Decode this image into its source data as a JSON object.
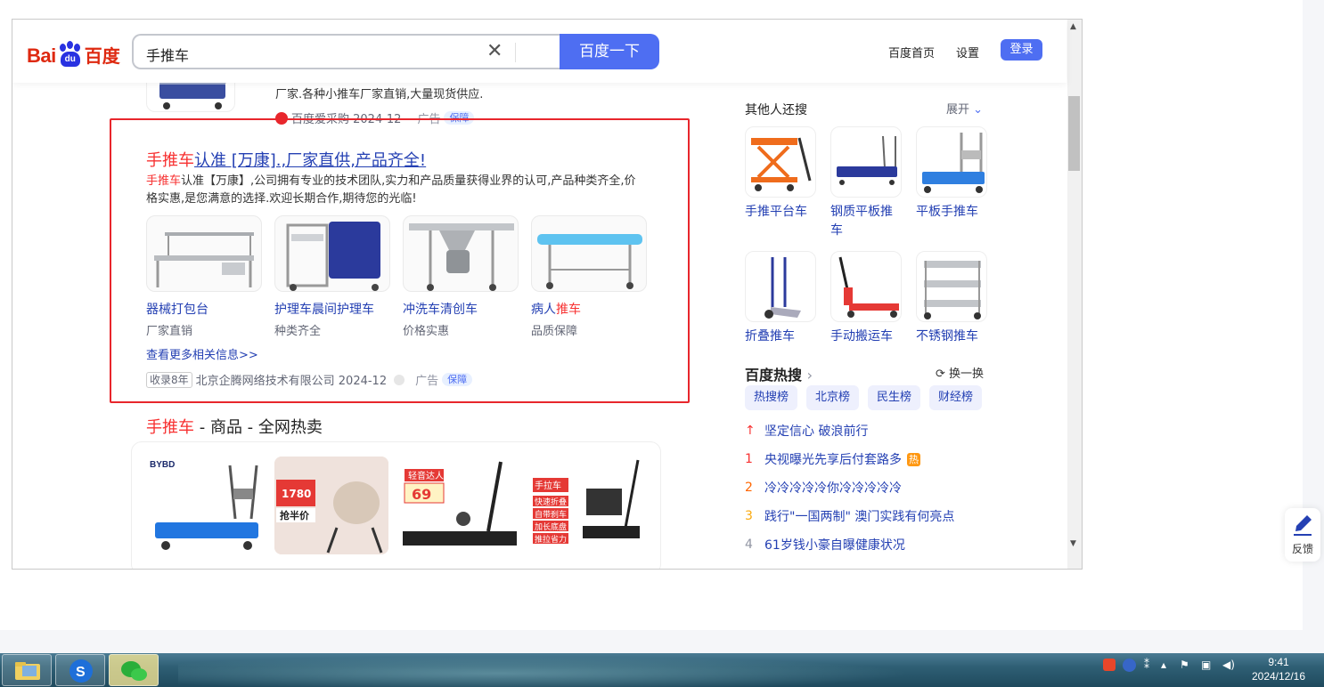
{
  "header": {
    "logo_bai": "Bai",
    "logo_du": "du",
    "logo_cn": "百度",
    "query": "手推车",
    "search_button": "百度一下",
    "nav_home": "百度首页",
    "nav_settings": "设置",
    "login": "登录"
  },
  "top_result": {
    "line1": "厂家.各种小推车厂家直销,大量现货供应.",
    "source": "百度爱采购 2024-12",
    "ad": "广告",
    "bao": "保障"
  },
  "ad_result": {
    "title_hl": "手推车",
    "title_rest": "认准 [万康].,厂家直供,产品齐全!",
    "snippet_hl": "手推车",
    "snippet_rest": "认准【万康】,公司拥有专业的技术团队,实力和产品质量获得业界的认可,产品种类齐全,价格实惠,是您满意的选择.欢迎长期合作,期待您的光临!",
    "tiles": [
      {
        "name": "器械打包台",
        "sub": "厂家直销"
      },
      {
        "name": "护理车晨间护理车",
        "sub": "种类齐全"
      },
      {
        "name": "冲洗车清创车",
        "sub": "价格实惠"
      },
      {
        "name_a": "病人",
        "name_b": "推车",
        "sub": "品质保障"
      }
    ],
    "more": "查看更多相关信息>>",
    "tag": "收录8年",
    "company": "北京企腾网络技术有限公司 2024-12",
    "ad": "广告",
    "bao": "保障"
  },
  "shopping": {
    "title_hl": "手推车",
    "title_rest": " - 商品 - 全网热卖",
    "p1_brand": "BYBD",
    "p2_price": "1780",
    "p2_promo": "抢半价",
    "p3_badge": "轻音达人",
    "p3_price": "69",
    "p4_badge": "手拉车",
    "p4_lines": [
      "快速折叠",
      "自带刹车",
      "加长底盘",
      "推拉省力"
    ]
  },
  "related": {
    "title": "其他人还搜",
    "expand": "展开",
    "items": [
      "手推平台车",
      "钢质平板推车",
      "平板手推车",
      "折叠推车",
      "手动搬运车",
      "不锈钢推车"
    ]
  },
  "hot": {
    "title": "百度热搜",
    "refresh": "换一换",
    "tabs": [
      "热搜榜",
      "北京榜",
      "民生榜",
      "财经榜"
    ],
    "rows": [
      {
        "rank": "↑",
        "text": "坚定信心 破浪前行",
        "color": "#f73131"
      },
      {
        "rank": "1",
        "text": "央视曝光先享后付套路多",
        "color": "#f73131",
        "tag": "热"
      },
      {
        "rank": "2",
        "text": "冷冷冷冷冷你冷冷冷冷冷",
        "color": "#ff6600"
      },
      {
        "rank": "3",
        "text": "践行\"一国两制\" 澳门实践有何亮点",
        "color": "#faa90e"
      },
      {
        "rank": "4",
        "text": "61岁钱小豪自曝健康状况",
        "color": "#9195a3"
      }
    ]
  },
  "feedback": "反馈",
  "taskbar": {
    "time": "9:41",
    "date": "2024/12/16"
  }
}
